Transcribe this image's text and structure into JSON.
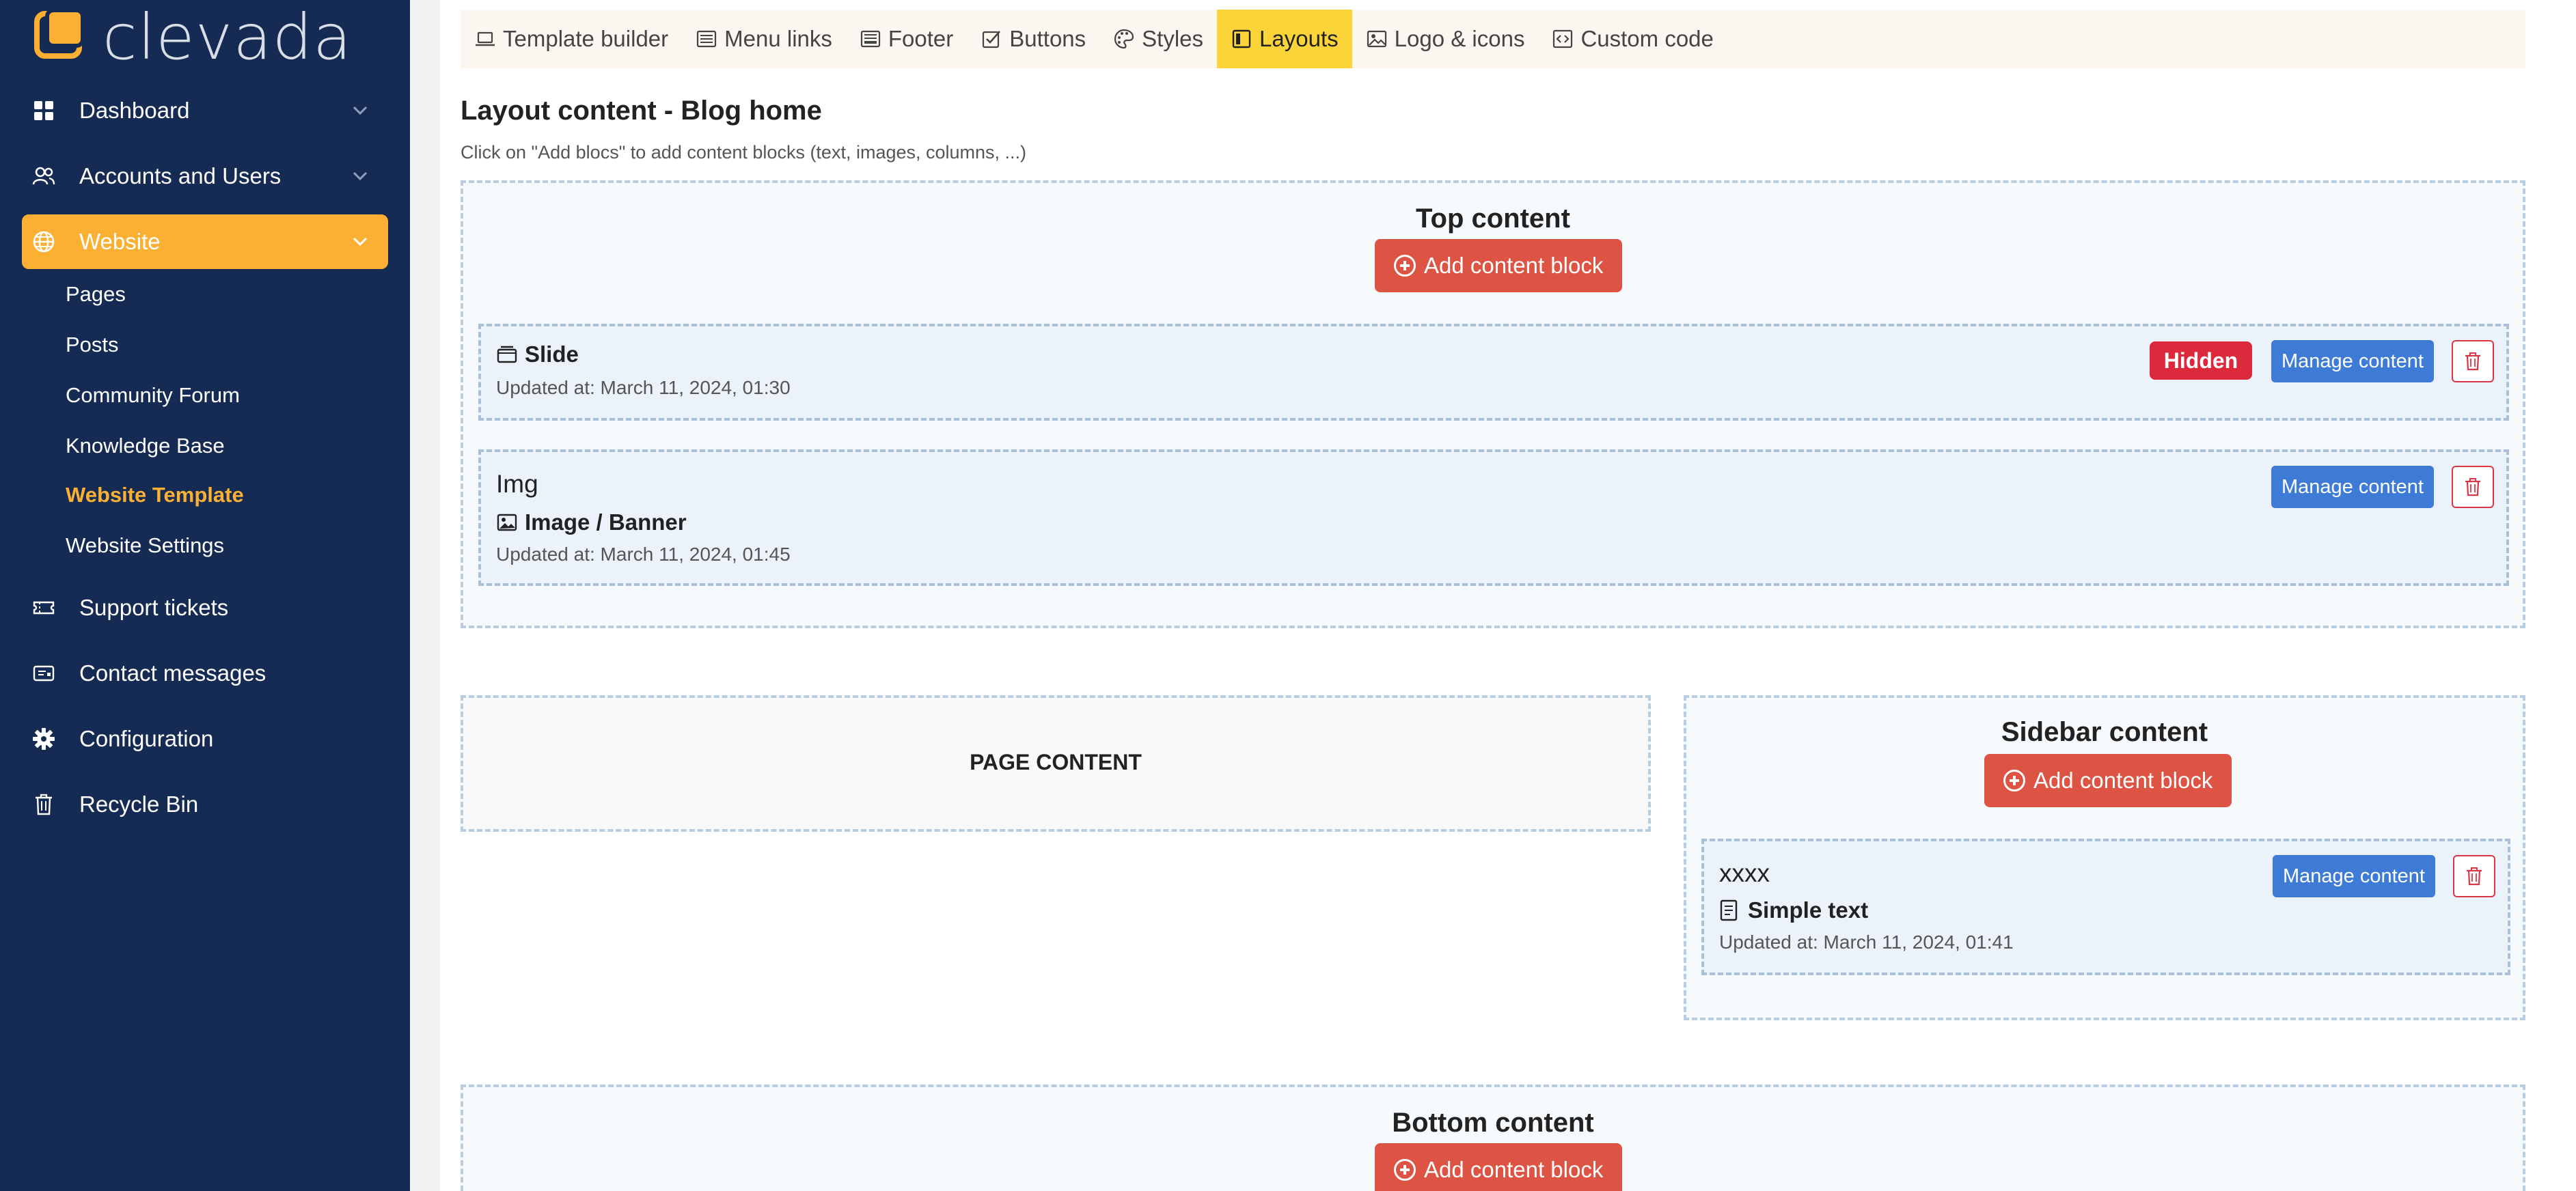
{
  "brand": {
    "name": "clevada",
    "accent": "#fbb034",
    "sidebar_bg": "#152b53"
  },
  "sidebar": {
    "items": [
      {
        "label": "Dashboard",
        "icon": "dashboard-icon",
        "has_chevron": true
      },
      {
        "label": "Accounts and Users",
        "icon": "users-icon",
        "has_chevron": true
      },
      {
        "label": "Website",
        "icon": "globe-icon",
        "has_chevron": true,
        "active": true
      },
      {
        "label": "Support tickets",
        "icon": "ticket-icon"
      },
      {
        "label": "Contact messages",
        "icon": "message-icon"
      },
      {
        "label": "Configuration",
        "icon": "gear-icon"
      },
      {
        "label": "Recycle Bin",
        "icon": "trash-icon"
      }
    ],
    "website_sub": [
      {
        "label": "Pages"
      },
      {
        "label": "Posts"
      },
      {
        "label": "Community Forum"
      },
      {
        "label": "Knowledge Base"
      },
      {
        "label": "Website Template",
        "current": true
      },
      {
        "label": "Website Settings"
      }
    ]
  },
  "tabs": [
    {
      "label": "Template builder",
      "icon": "laptop-icon"
    },
    {
      "label": "Menu links",
      "icon": "menu-icon"
    },
    {
      "label": "Footer",
      "icon": "footer-icon"
    },
    {
      "label": "Buttons",
      "icon": "checkbox-icon"
    },
    {
      "label": "Styles",
      "icon": "palette-icon"
    },
    {
      "label": "Layouts",
      "icon": "layout-icon",
      "active": true
    },
    {
      "label": "Logo & icons",
      "icon": "image-icon"
    },
    {
      "label": "Custom code",
      "icon": "code-icon"
    }
  ],
  "page": {
    "title": "Layout content - Blog home",
    "hint": "Click on \"Add blocs\" to add content blocks (text, images, columns, ...)"
  },
  "zones": {
    "top": {
      "title": "Top content",
      "add_label": "Add content block",
      "blocks": [
        {
          "name": "",
          "type": "Slide",
          "type_icon": "slide-icon",
          "updated": "Updated at: March 11, 2024, 01:30",
          "badge": "Hidden",
          "manage_label": "Manage content"
        },
        {
          "name": "Img",
          "type": "Image / Banner",
          "type_icon": "image-icon",
          "updated": "Updated at: March 11, 2024, 01:45",
          "manage_label": "Manage content"
        }
      ]
    },
    "page_content": {
      "label": "PAGE CONTENT"
    },
    "sidebar": {
      "title": "Sidebar content",
      "add_label": "Add content block",
      "blocks": [
        {
          "name": "xxxx",
          "type": "Simple text",
          "type_icon": "document-icon",
          "updated": "Updated at: March 11, 2024, 01:41",
          "manage_label": "Manage content"
        }
      ]
    },
    "bottom": {
      "title": "Bottom content",
      "add_label": "Add content block"
    }
  }
}
